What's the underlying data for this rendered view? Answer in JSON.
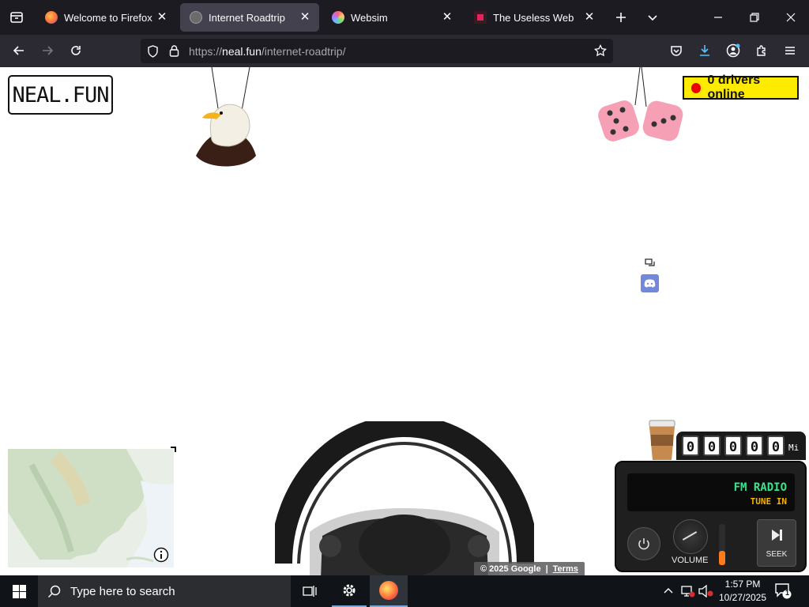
{
  "browser": {
    "tabs": [
      {
        "title": "Welcome to Firefox",
        "active": false,
        "favicon_color": "#ff7139"
      },
      {
        "title": "Internet Roadtrip",
        "active": true,
        "favicon_color": "#7a7a7a"
      },
      {
        "title": "Websim",
        "active": false,
        "favicon_color": "#6fb6ff"
      },
      {
        "title": "The Useless Web",
        "active": false,
        "favicon_color": "#e0245e"
      }
    ],
    "url_prefix": "https://",
    "url_host": "neal.fun",
    "url_path": "/internet-roadtrip/"
  },
  "page": {
    "logo": "NEAL.FUN",
    "drivers_online": "0 drivers online",
    "odometer_digits": [
      "0",
      "0",
      "0",
      "0",
      "0"
    ],
    "odometer_unit": "Mi",
    "radio": {
      "band": "FM RADIO",
      "status": "TUNE IN",
      "volume_label": "VOLUME",
      "seek_label": "SEEK",
      "volume_level": 0.35
    },
    "map_copyright": "© 2025 Google",
    "map_terms": "Terms"
  },
  "taskbar": {
    "search_placeholder": "Type here to search",
    "time": "1:57 PM",
    "date": "10/27/2025",
    "notification_count": "1"
  },
  "colors": {
    "accent_yellow": "#ffeb00",
    "online_dot": "#ee0000",
    "radio_green": "#39e58c",
    "radio_amber": "#f5b400"
  }
}
